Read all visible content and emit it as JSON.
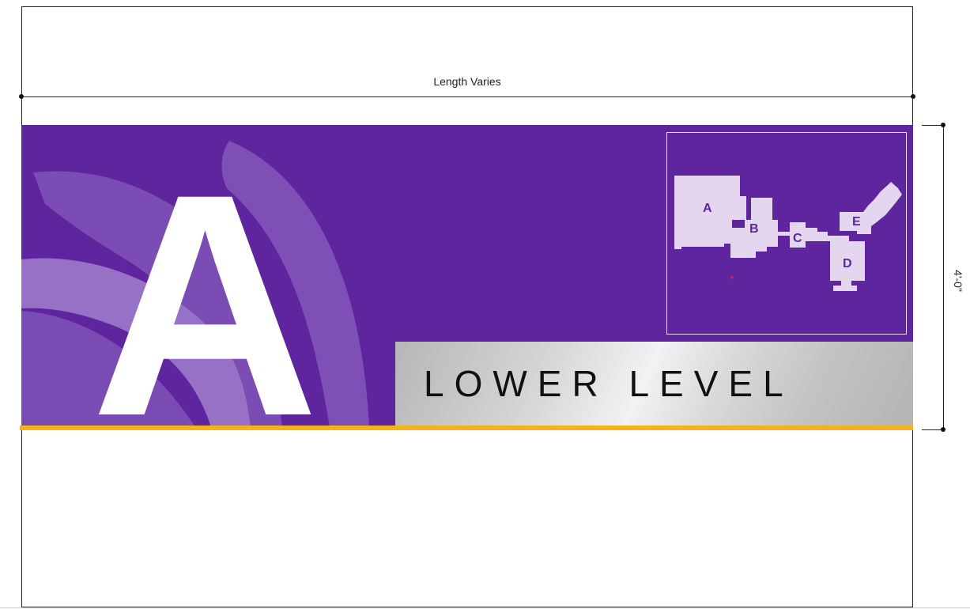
{
  "dimensions": {
    "width_label": "Length Varies",
    "height_label": "4'-0\""
  },
  "sign": {
    "building_letter": "A",
    "level_label": "LOWER LEVEL",
    "colors": {
      "background": "#5f259f",
      "petal": "#8a5bbf",
      "accent_bar": "#f6b21a",
      "map_fill": "#e3d6ee",
      "map_label": "#5f259f",
      "you_are_here": "#e0245e"
    }
  },
  "map": {
    "building_labels": [
      "A",
      "B",
      "C",
      "D",
      "E"
    ]
  }
}
